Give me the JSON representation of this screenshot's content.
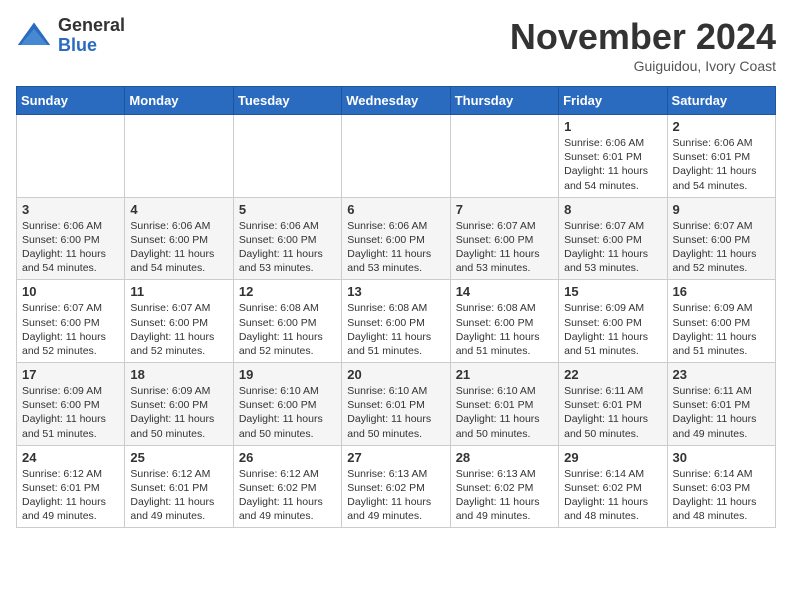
{
  "logo": {
    "general": "General",
    "blue": "Blue"
  },
  "title": "November 2024",
  "location": "Guiguidou, Ivory Coast",
  "days_of_week": [
    "Sunday",
    "Monday",
    "Tuesday",
    "Wednesday",
    "Thursday",
    "Friday",
    "Saturday"
  ],
  "weeks": [
    [
      null,
      null,
      null,
      null,
      null,
      {
        "day": 1,
        "sunrise": "6:06 AM",
        "sunset": "6:01 PM",
        "daylight": "11 hours and 54 minutes."
      },
      {
        "day": 2,
        "sunrise": "6:06 AM",
        "sunset": "6:01 PM",
        "daylight": "11 hours and 54 minutes."
      }
    ],
    [
      {
        "day": 3,
        "sunrise": "6:06 AM",
        "sunset": "6:00 PM",
        "daylight": "11 hours and 54 minutes."
      },
      {
        "day": 4,
        "sunrise": "6:06 AM",
        "sunset": "6:00 PM",
        "daylight": "11 hours and 54 minutes."
      },
      {
        "day": 5,
        "sunrise": "6:06 AM",
        "sunset": "6:00 PM",
        "daylight": "11 hours and 53 minutes."
      },
      {
        "day": 6,
        "sunrise": "6:06 AM",
        "sunset": "6:00 PM",
        "daylight": "11 hours and 53 minutes."
      },
      {
        "day": 7,
        "sunrise": "6:07 AM",
        "sunset": "6:00 PM",
        "daylight": "11 hours and 53 minutes."
      },
      {
        "day": 8,
        "sunrise": "6:07 AM",
        "sunset": "6:00 PM",
        "daylight": "11 hours and 53 minutes."
      },
      {
        "day": 9,
        "sunrise": "6:07 AM",
        "sunset": "6:00 PM",
        "daylight": "11 hours and 52 minutes."
      }
    ],
    [
      {
        "day": 10,
        "sunrise": "6:07 AM",
        "sunset": "6:00 PM",
        "daylight": "11 hours and 52 minutes."
      },
      {
        "day": 11,
        "sunrise": "6:07 AM",
        "sunset": "6:00 PM",
        "daylight": "11 hours and 52 minutes."
      },
      {
        "day": 12,
        "sunrise": "6:08 AM",
        "sunset": "6:00 PM",
        "daylight": "11 hours and 52 minutes."
      },
      {
        "day": 13,
        "sunrise": "6:08 AM",
        "sunset": "6:00 PM",
        "daylight": "11 hours and 51 minutes."
      },
      {
        "day": 14,
        "sunrise": "6:08 AM",
        "sunset": "6:00 PM",
        "daylight": "11 hours and 51 minutes."
      },
      {
        "day": 15,
        "sunrise": "6:09 AM",
        "sunset": "6:00 PM",
        "daylight": "11 hours and 51 minutes."
      },
      {
        "day": 16,
        "sunrise": "6:09 AM",
        "sunset": "6:00 PM",
        "daylight": "11 hours and 51 minutes."
      }
    ],
    [
      {
        "day": 17,
        "sunrise": "6:09 AM",
        "sunset": "6:00 PM",
        "daylight": "11 hours and 51 minutes."
      },
      {
        "day": 18,
        "sunrise": "6:09 AM",
        "sunset": "6:00 PM",
        "daylight": "11 hours and 50 minutes."
      },
      {
        "day": 19,
        "sunrise": "6:10 AM",
        "sunset": "6:00 PM",
        "daylight": "11 hours and 50 minutes."
      },
      {
        "day": 20,
        "sunrise": "6:10 AM",
        "sunset": "6:01 PM",
        "daylight": "11 hours and 50 minutes."
      },
      {
        "day": 21,
        "sunrise": "6:10 AM",
        "sunset": "6:01 PM",
        "daylight": "11 hours and 50 minutes."
      },
      {
        "day": 22,
        "sunrise": "6:11 AM",
        "sunset": "6:01 PM",
        "daylight": "11 hours and 50 minutes."
      },
      {
        "day": 23,
        "sunrise": "6:11 AM",
        "sunset": "6:01 PM",
        "daylight": "11 hours and 49 minutes."
      }
    ],
    [
      {
        "day": 24,
        "sunrise": "6:12 AM",
        "sunset": "6:01 PM",
        "daylight": "11 hours and 49 minutes."
      },
      {
        "day": 25,
        "sunrise": "6:12 AM",
        "sunset": "6:01 PM",
        "daylight": "11 hours and 49 minutes."
      },
      {
        "day": 26,
        "sunrise": "6:12 AM",
        "sunset": "6:02 PM",
        "daylight": "11 hours and 49 minutes."
      },
      {
        "day": 27,
        "sunrise": "6:13 AM",
        "sunset": "6:02 PM",
        "daylight": "11 hours and 49 minutes."
      },
      {
        "day": 28,
        "sunrise": "6:13 AM",
        "sunset": "6:02 PM",
        "daylight": "11 hours and 49 minutes."
      },
      {
        "day": 29,
        "sunrise": "6:14 AM",
        "sunset": "6:02 PM",
        "daylight": "11 hours and 48 minutes."
      },
      {
        "day": 30,
        "sunrise": "6:14 AM",
        "sunset": "6:03 PM",
        "daylight": "11 hours and 48 minutes."
      }
    ]
  ]
}
